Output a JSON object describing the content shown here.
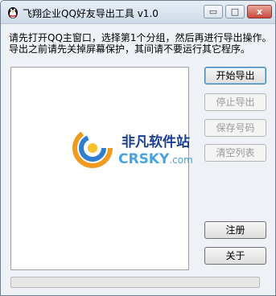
{
  "window": {
    "title": "飞翔企业QQ好友导出工具 v1.0",
    "buttons": {
      "minimize": "▭",
      "maximize": "□",
      "close": "x"
    }
  },
  "instructions": {
    "line1": "请先打开QQ主窗口，选择第1个分组，然后再进行导出操作。",
    "line2": "导出之前请先关掉屏幕保护，其间请不要运行其它程序。"
  },
  "buttons": {
    "start": "开始导出",
    "stop": "停止导出",
    "save": "保存号码",
    "clear": "清空列表",
    "register": "注册",
    "about": "关于"
  },
  "watermark": {
    "text_cn": "非凡软件站",
    "text_en": "CRSKY",
    "text_domain": ".com"
  },
  "progress": {
    "value": 0
  },
  "colors": {
    "progress_fill": "#06b025",
    "watermark_dark": "#1a3f8f",
    "watermark_light": "#4aa3e0"
  }
}
